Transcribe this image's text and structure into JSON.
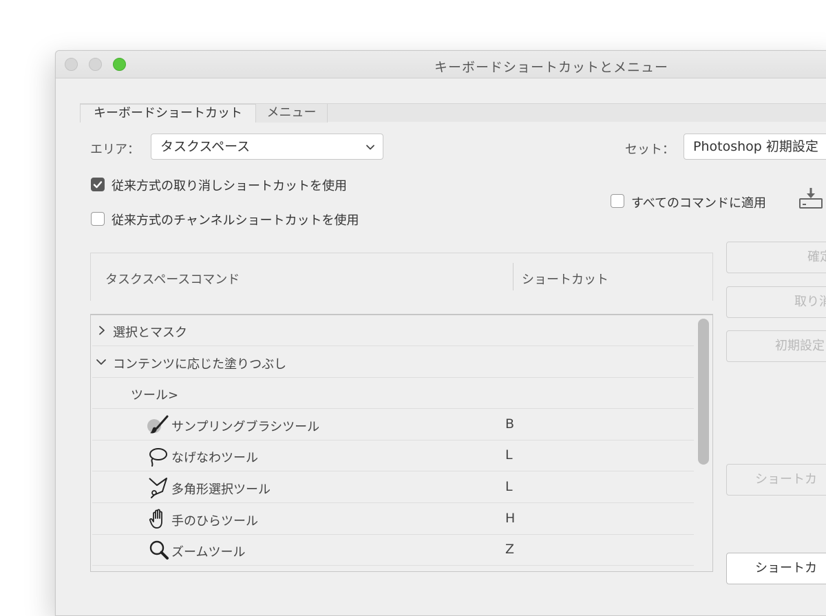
{
  "window": {
    "title": "キーボードショートカットとメニュー"
  },
  "tabs": [
    {
      "label": "キーボードショートカット",
      "active": true
    },
    {
      "label": "メニュー",
      "active": false
    }
  ],
  "area": {
    "label": "エリア：",
    "value": "タスクスペース"
  },
  "set": {
    "label": "セット：",
    "value": "Photoshop 初期設定"
  },
  "options": {
    "legacy_undo": {
      "label": "従来方式の取り消しショートカットを使用",
      "checked": true
    },
    "legacy_channel": {
      "label": "従来方式のチャンネルショートカットを使用",
      "checked": false
    },
    "apply_all": {
      "label": "すべてのコマンドに適用",
      "checked": false
    }
  },
  "table": {
    "headers": {
      "command": "タスクスペースコマンド",
      "shortcut": "ショートカット"
    },
    "rows": [
      {
        "label": "選択とマスク",
        "shortcut": "",
        "icon": "chevron-right-icon"
      },
      {
        "label": "コンテンツに応じた塗りつぶし",
        "shortcut": "",
        "icon": "chevron-down-icon"
      },
      {
        "label": "ツール>",
        "shortcut": "",
        "icon": ""
      },
      {
        "label": "サンプリングブラシツール",
        "shortcut": "B",
        "icon": "sampling-brush-icon"
      },
      {
        "label": "なげなわツール",
        "shortcut": "L",
        "icon": "lasso-icon"
      },
      {
        "label": "多角形選択ツール",
        "shortcut": "L",
        "icon": "polygonal-lasso-icon"
      },
      {
        "label": "手のひらツール",
        "shortcut": "H",
        "icon": "hand-icon"
      },
      {
        "label": "ズームツール",
        "shortcut": "Z",
        "icon": "zoom-icon"
      }
    ]
  },
  "buttons": {
    "accept": "確定",
    "undo": "取り消",
    "defaults": "初期設定",
    "add_shortcut": "ショートカ",
    "summarize": "ショートカ"
  },
  "colors": {
    "accent_green": "#5ac93f",
    "window_bg": "#efefef",
    "disabled_text": "#b9b9b9"
  }
}
